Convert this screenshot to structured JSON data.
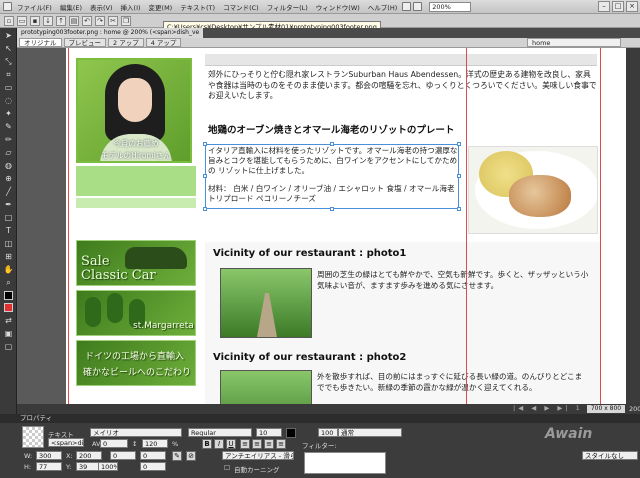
{
  "menubar": {
    "items": [
      "ファイル(F)",
      "編集(E)",
      "表示(V)",
      "挿入(I)",
      "変更(M)",
      "テキスト(T)",
      "コマンド(C)",
      "フィルター(L)",
      "ウィンドウ(W)",
      "ヘルプ(H)"
    ],
    "zoom": "200%",
    "window_buttons": [
      "–",
      "□",
      "×"
    ]
  },
  "tooltip": {
    "path": "C:¥Users¥cs¥Desktop¥サンプル素材01¥prototyping003footer.png"
  },
  "document": {
    "tab": "prototyping003footer.png : home @ 200% (<span>dish_ve"
  },
  "viewbar": {
    "tabs": [
      "オリジナル",
      "プレビュー",
      "2 アップ",
      "4 アップ"
    ],
    "page_label": "home"
  },
  "webpage": {
    "photo_caption_1": "今月のお薦め",
    "photo_caption_2": "モデルのHiromiさん",
    "intro": "郊外にひっそりと佇む隠れ家レストランSuburban Haus Abendessen。洋式の歴史ある建物を改良し、家具や食器は当時のものをそのまま使います。都会の喧騒を忘れ、ゆっくりとくつろいでください。美味しい食事でお迎えいたします。",
    "heading": "地鶏のオーブン焼きとオマール海老のリゾットのプレート",
    "description": "イタリア直輸入に材料を使ったリゾットです。オマール海老の持つ濃厚な旨みとコクを堪能してもらうために、白ワインをアクセントにしてかための リゾットに仕上げました。",
    "ingredients": "材料： 白米 / 白ワイン / オリーブ油 / エシャロット 食塩 / オマール海老 トリプロード ペコリーノチーズ",
    "banner1_line1": "Sale",
    "banner1_line2": "Classic Car",
    "banner2_text": "st.Margarreta",
    "banner3_line1": "ドイツの工場から直輸入",
    "banner3_line2": "確かなビールへのこだわり",
    "section1_title": "Vicinity of our restaurant : photo1",
    "section1_text": "周囲の芝生の緑はとても鮮やかで、空気も新鮮です。歩くと、ザッザッという小気味よい音が、ますます歩みを進める気にさせます。",
    "section2_title": "Vicinity of our restaurant : photo2",
    "section2_text": "外を散歩すれば、目の前にはまっすぐに延びる長い緑の道。のんびりとどこまででも歩きたい。新緑の季節の霞かな緑が温かく迎えてくれる。"
  },
  "status": {
    "nav": "|◀ ◀ ▶ ▶| 1",
    "dimensions": "700 x 800",
    "zoom": "200%"
  },
  "properties": {
    "title": "プロパティ",
    "kind": "テキスト",
    "object_name": "<span>dish_ve",
    "font": "メイリオ",
    "style": "Regular",
    "size": "10",
    "opacity": "100",
    "blend": "通常",
    "filter_label": "フィルター:",
    "w": "300",
    "h": "77",
    "x": "200",
    "y": "39",
    "tracking": "0",
    "leading": "120",
    "leading_unit": "%",
    "indent": "0",
    "space": "0",
    "scale": "100%",
    "antialias": "アンチエイリアス - 滑らかに",
    "auto_kerning": "自動カーニング",
    "style_none": "スタイルなし"
  },
  "watermark": "Awain"
}
